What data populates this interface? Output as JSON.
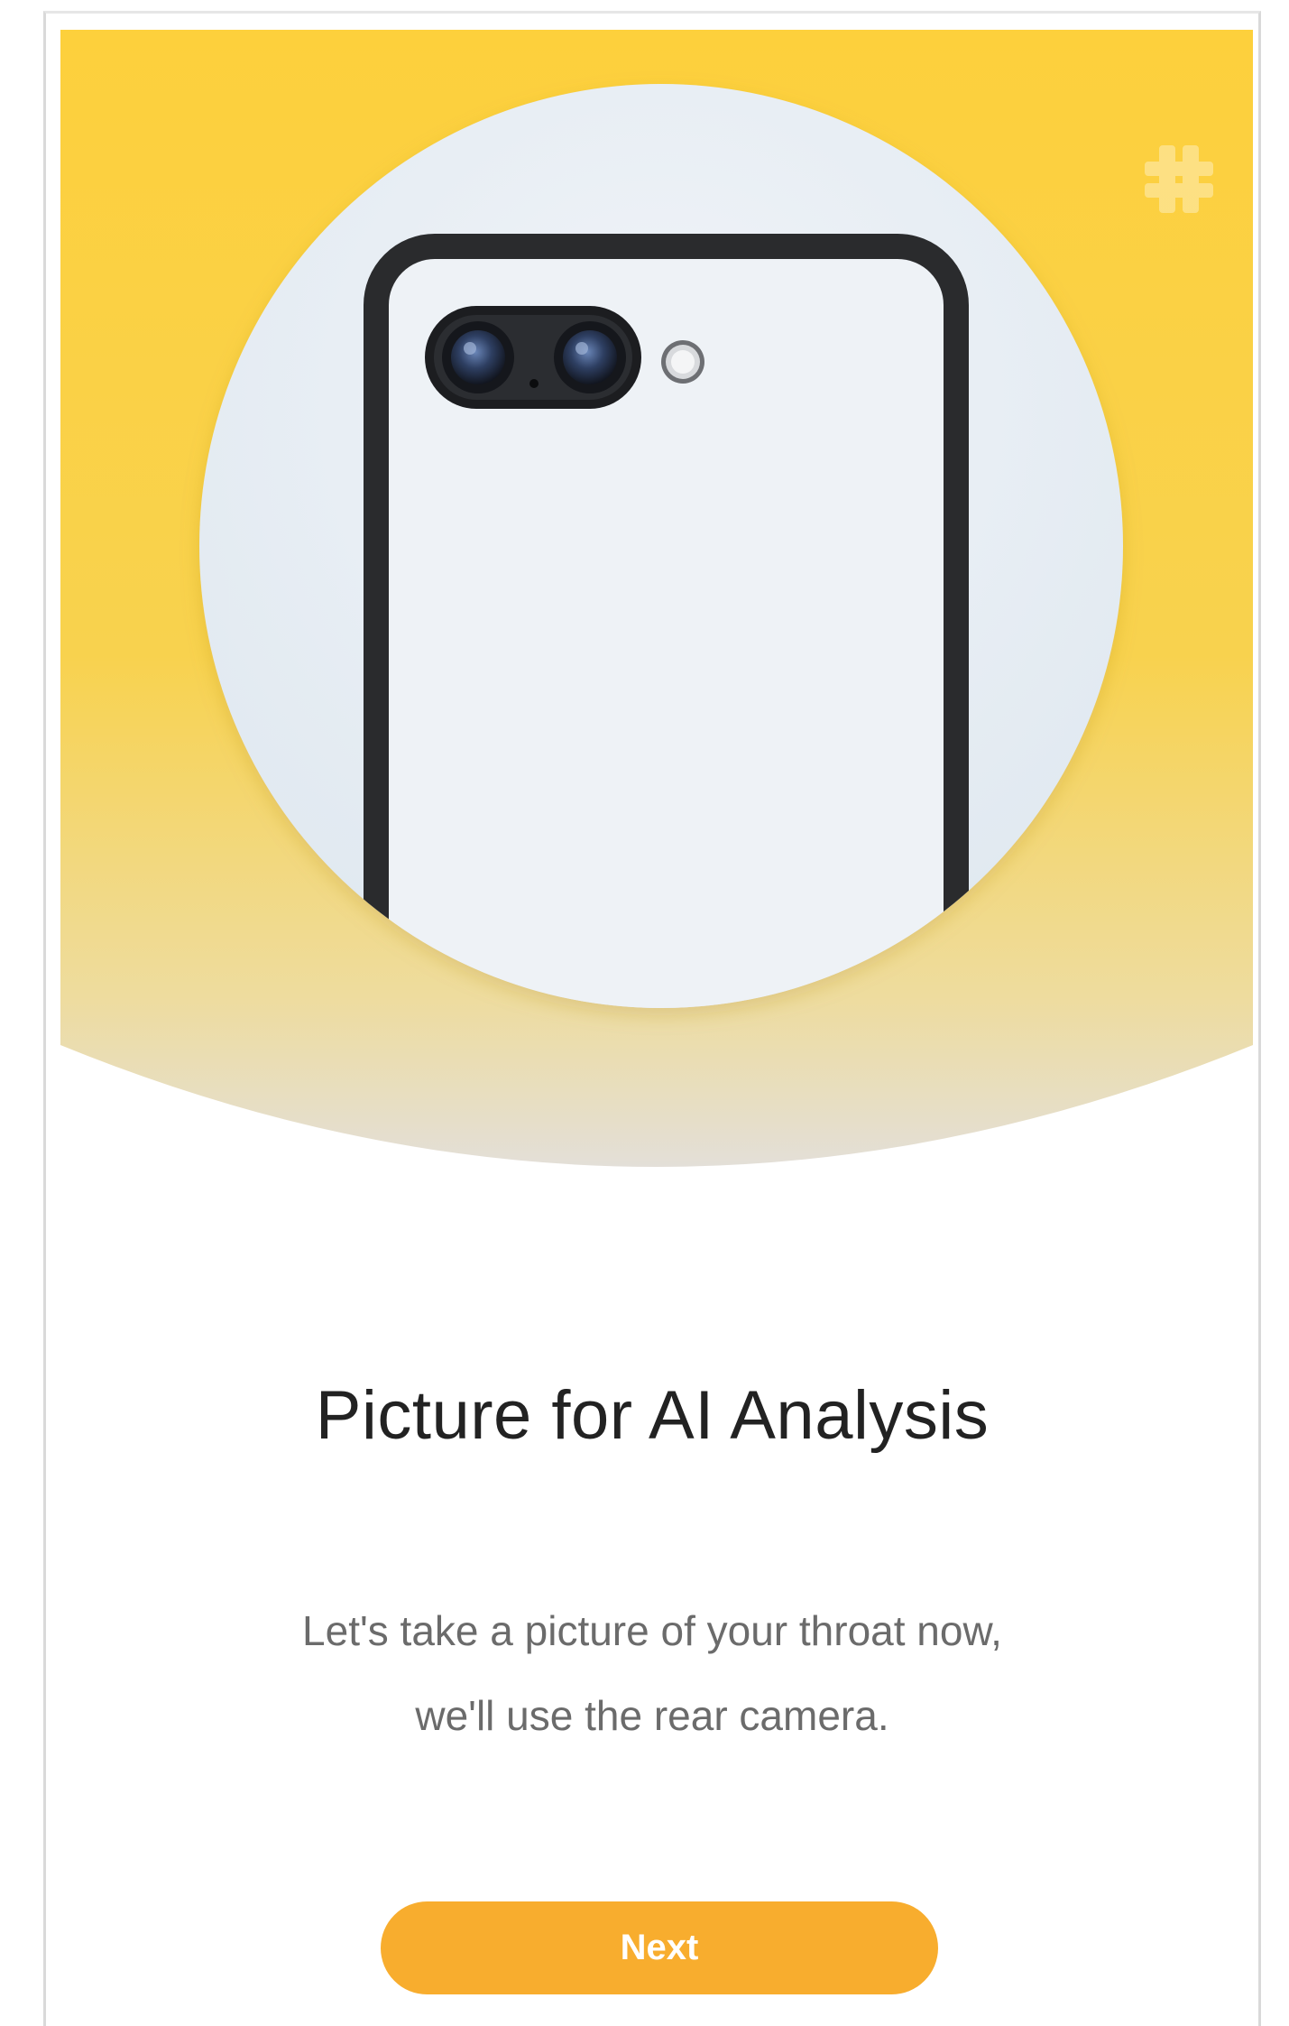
{
  "screen": {
    "title": "Picture for AI Analysis",
    "description_line1": "Let's take a picture of your throat now,",
    "description_line2": "we'll use the rear camera.",
    "next_label": "Next"
  },
  "hero": {
    "illustration": "phone-rear-camera",
    "decorative_icon": "medical-cross-icon"
  },
  "colors": {
    "hero_top": "#fdd03c",
    "hero_bottom": "#e3dfd8",
    "circle_fill": "#e8eef4",
    "phone_frame": "#2a2b2d",
    "button": "#f8ad2e",
    "title_text": "#222222",
    "body_text": "#6b6b6b"
  }
}
